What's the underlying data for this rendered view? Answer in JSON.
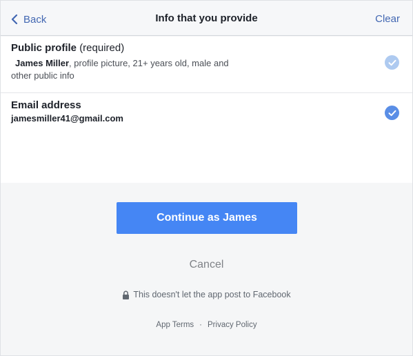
{
  "header": {
    "back_label": "Back",
    "title": "Info that you provide",
    "clear_label": "Clear"
  },
  "permissions": [
    {
      "title": "Public profile",
      "qualifier": "(required)",
      "name": "James Miller",
      "description": ", profile picture, 21+ years old, male and other public info",
      "checked": true,
      "locked": true
    },
    {
      "title": "Email address",
      "value": "jamesmiller41@gmail.com",
      "checked": true,
      "locked": false
    }
  ],
  "actions": {
    "continue_label": "Continue as James",
    "cancel_label": "Cancel"
  },
  "notice": "This doesn't let the app post to Facebook",
  "footer_links": {
    "app_terms": "App Terms",
    "separator": "·",
    "privacy_policy": "Privacy Policy"
  },
  "colors": {
    "link_blue": "#4267b2",
    "button_blue": "#4586f4",
    "check_active": "#5a8ee6",
    "check_locked": "#aecaf0"
  },
  "icons": {
    "back": "chevron-left-icon",
    "check": "checkmark-icon",
    "lock": "lock-icon"
  }
}
